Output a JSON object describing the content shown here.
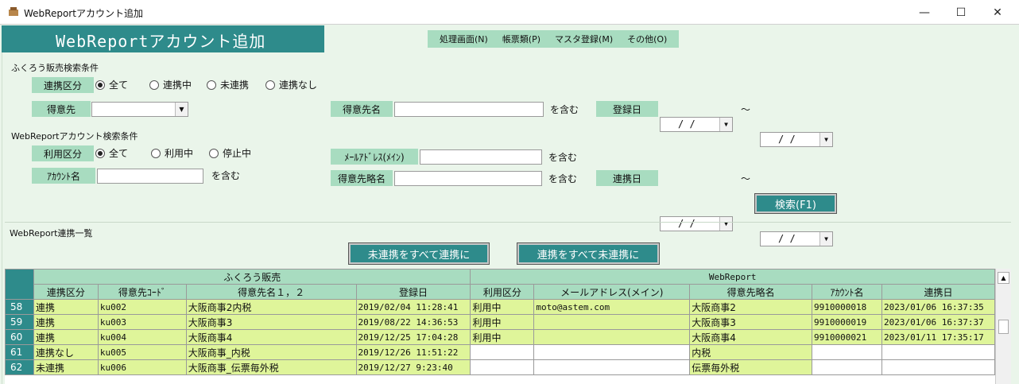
{
  "window": {
    "title": "WebReportアカウント追加",
    "minimize": "—",
    "maximize": "☐",
    "close": "✕"
  },
  "app_title": "WebReportアカウント追加",
  "menu": [
    "処理画面(N)",
    "帳票類(P)",
    "マスタ登録(M)",
    "その他(O)"
  ],
  "fukurou": {
    "section_title": "ふくろう販売検索条件",
    "renkei_label": "連携区分",
    "renkei_options": [
      {
        "label": "全て",
        "selected": true
      },
      {
        "label": "連携中",
        "selected": false
      },
      {
        "label": "未連携",
        "selected": false
      },
      {
        "label": "連携なし",
        "selected": false
      }
    ],
    "tokuisaki_label": "得意先",
    "tokuisaki_value": "",
    "tokuisaki_name_label": "得意先名",
    "tokuisaki_name_value": "",
    "contains": "を含む",
    "touroku_label": "登録日",
    "date_placeholder": "/ /",
    "tilde": "～"
  },
  "webreport": {
    "section_title": "WebReportアカウント検索条件",
    "riyou_label": "利用区分",
    "riyou_options": [
      {
        "label": "全て",
        "selected": true
      },
      {
        "label": "利用中",
        "selected": false
      },
      {
        "label": "停止中",
        "selected": false
      }
    ],
    "mail_label": "ﾒｰﾙｱﾄﾞﾚｽ(ﾒｲﾝ)",
    "mail_value": "",
    "account_label": "ｱｶｳﾝﾄ名",
    "account_value": "",
    "ryakumei_label": "得意先略名",
    "ryakumei_value": "",
    "contains": "を含む",
    "renkeibi_label": "連携日",
    "date_placeholder": "/ /",
    "tilde": "～"
  },
  "search_button": "検索(F1)",
  "list_title": "WebReport連携一覧",
  "bulk_buttons": {
    "link_all": "未連携をすべて連携に",
    "unlink_all": "連携をすべて未連携に"
  },
  "grid": {
    "group_headers": [
      "ふくろう販売",
      "WebReport"
    ],
    "columns": [
      "連携区分",
      "得意先ｺｰﾄﾞ",
      "得意先名１，２",
      "登録日",
      "利用区分",
      "メールアドレス(メイン)",
      "得意先略名",
      "ｱｶｳﾝﾄ名",
      "連携日"
    ],
    "rows": [
      {
        "no": "58",
        "kubun": "連携",
        "code": "ku002",
        "name": "大阪商事2内税",
        "date": "2019/02/04 11:28:41",
        "riyou": "利用中",
        "mail": "moto@astem.com",
        "ryaku": "大阪商事2",
        "account": "9910000018",
        "renkei": "2023/01/06 16:37:35",
        "linked": true
      },
      {
        "no": "59",
        "kubun": "連携",
        "code": "ku003",
        "name": "大阪商事3",
        "date": "2019/08/22 14:36:53",
        "riyou": "利用中",
        "mail": "",
        "ryaku": "大阪商事3",
        "account": "9910000019",
        "renkei": "2023/01/06 16:37:37",
        "linked": true
      },
      {
        "no": "60",
        "kubun": "連携",
        "code": "ku004",
        "name": "大阪商事4",
        "date": "2019/12/25 17:04:28",
        "riyou": "利用中",
        "mail": "",
        "ryaku": "大阪商事4",
        "account": "9910000021",
        "renkei": "2023/01/11 17:35:17",
        "linked": true
      },
      {
        "no": "61",
        "kubun": "連携なし",
        "code": "ku005",
        "name": "大阪商事_内税",
        "date": "2019/12/26 11:51:22",
        "riyou": "",
        "mail": "",
        "ryaku": "内税",
        "account": "",
        "renkei": "",
        "linked": false
      },
      {
        "no": "62",
        "kubun": "未連携",
        "code": "ku006",
        "name": "大阪商事_伝票毎外税",
        "date": "2019/12/27 9:23:40",
        "riyou": "",
        "mail": "",
        "ryaku": "伝票毎外税",
        "account": "",
        "renkei": "",
        "linked": false
      }
    ]
  }
}
